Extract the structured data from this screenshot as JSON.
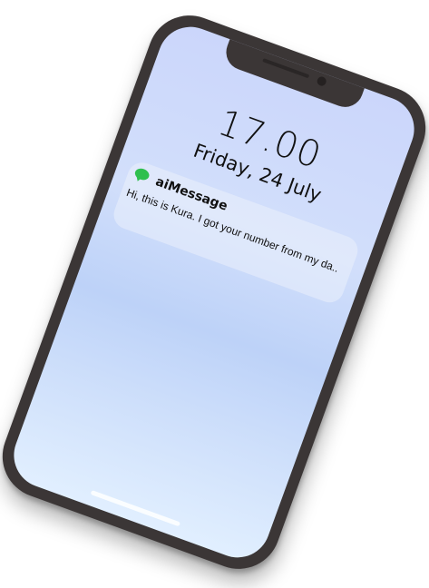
{
  "lock_screen": {
    "time": "17.00",
    "date": "Friday, 24 July"
  },
  "notification": {
    "app_icon": "message-bubble-icon",
    "app_name": "aiMessage",
    "message": "Hi, this is Kura. I got your number from my da.."
  },
  "colors": {
    "phone_frame": "#3b3636",
    "screen_top": "#cbd6fb",
    "screen_bottom": "#e1efff",
    "app_icon_green": "#2fbf4e"
  }
}
